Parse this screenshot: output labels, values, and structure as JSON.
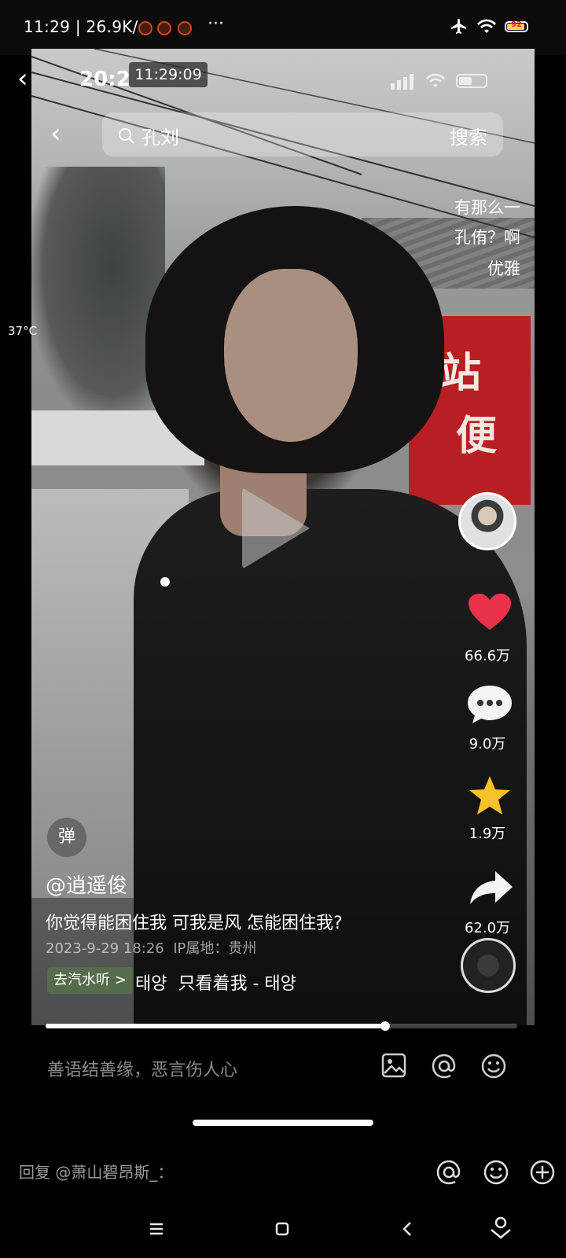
{
  "status_bar": {
    "time": "11:29",
    "speed": "| 26.9K/s",
    "more": "···",
    "battery": "92"
  },
  "video": {
    "inner_time": "20:2",
    "timestamp": "11:29:09",
    "search_query": "孔刘",
    "search_button": "搜索",
    "caption_lines": [
      "有那么一",
      "孔侑？啊",
      "优雅"
    ],
    "temperature": "37°C",
    "danmu_label": "弹",
    "author": "@逍遥俊",
    "description": "你觉得能困住我 可我是风 怎能困住我?",
    "date": "2023-9-29 18:26",
    "ip_location": "IP属地：贵州",
    "qishui_label": "去汽水听 >",
    "song": "태양  只看着我 - 태양",
    "progress_fraction": 0.72
  },
  "right_rail": {
    "likes": "66.6万",
    "comments": "9.0万",
    "favorites": "1.9万",
    "shares": "62.0万"
  },
  "comment_bar": {
    "placeholder": "善语结善缘，恶言伤人心"
  },
  "reply_bar": {
    "placeholder": "回复 @萧山碧昂斯_："
  },
  "colors": {
    "like_red": "#e8334a",
    "star_yellow": "#f8c02a"
  }
}
